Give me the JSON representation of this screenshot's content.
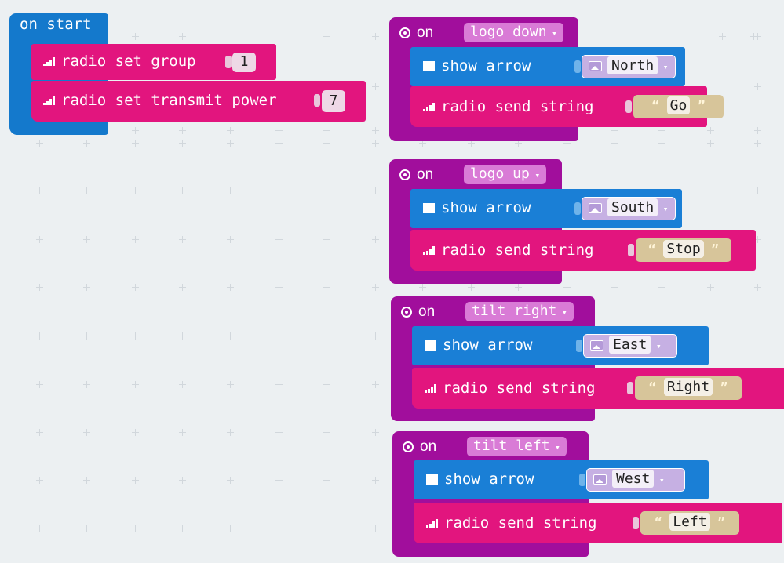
{
  "on_start": {
    "label": "on start",
    "blocks": [
      {
        "label": "radio set group",
        "value": "1"
      },
      {
        "label": "radio set transmit power",
        "value": "7"
      }
    ]
  },
  "events": [
    {
      "on": "on",
      "gesture": "logo down",
      "arrow_label": "show arrow",
      "direction": "North",
      "send_label": "radio send string",
      "message": "Go"
    },
    {
      "on": "on",
      "gesture": "logo up",
      "arrow_label": "show arrow",
      "direction": "South",
      "send_label": "radio send string",
      "message": "Stop"
    },
    {
      "on": "on",
      "gesture": "tilt right",
      "arrow_label": "show arrow",
      "direction": "East",
      "send_label": "radio send string",
      "message": "Right"
    },
    {
      "on": "on",
      "gesture": "tilt left",
      "arrow_label": "show arrow",
      "direction": "West",
      "send_label": "radio send string",
      "message": "Left"
    }
  ],
  "glyphs": {
    "caret": "▾",
    "open_quote": "“",
    "close_quote": "”"
  },
  "colors": {
    "input_block": "#e2157e",
    "event_block": "#a10e9c",
    "start_block": "#1479cc",
    "basic_block": "#1a7fd6",
    "workspace": "#ecf0f2"
  }
}
